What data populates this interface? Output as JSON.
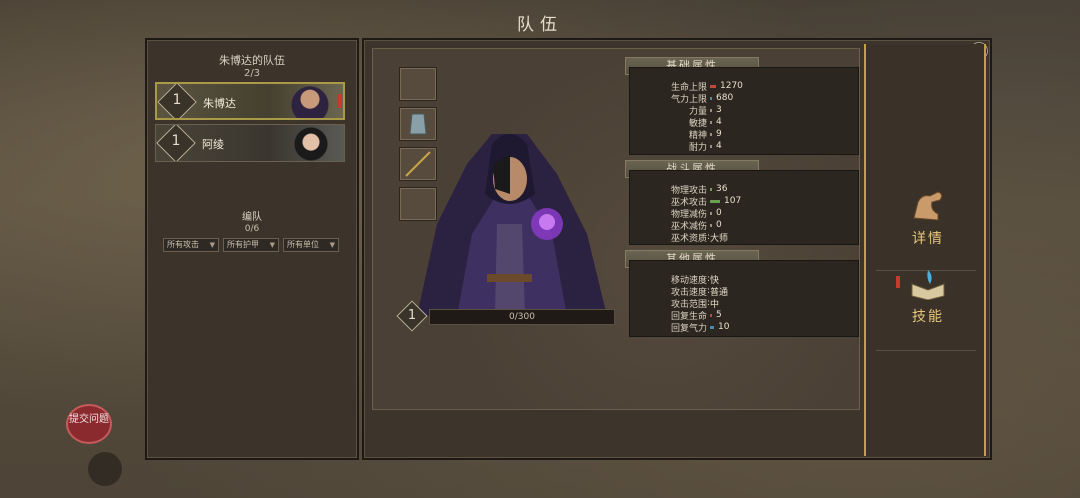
{
  "window_title": "队伍",
  "party": {
    "title": "朱博达的队伍",
    "count": "2/3",
    "members": [
      {
        "level": "1",
        "name": "朱博达",
        "selected": true
      },
      {
        "level": "1",
        "name": "阿绫",
        "selected": false
      }
    ],
    "formation_title": "编队",
    "formation_count": "0/6",
    "filters": [
      "所有攻击",
      "所有护甲",
      "所有单位"
    ]
  },
  "hero": {
    "level": "1",
    "exp": "0/300"
  },
  "sections": [
    {
      "title": "基础属性",
      "rows": [
        {
          "label": "生命上限",
          "sep": "",
          "value": "1270",
          "bar_color": "#c04a3a",
          "fill": 0.05
        },
        {
          "label": "气力上限",
          "sep": "",
          "value": "680",
          "bar_color": "#4a8ab0",
          "fill": 0.02
        },
        {
          "label": "力量",
          "sep": "",
          "value": "3",
          "bar_color": "#9a8f7c",
          "fill": 0.0
        },
        {
          "label": "敏捷",
          "sep": "",
          "value": "4",
          "bar_color": "#9a8f7c",
          "fill": 0.0
        },
        {
          "label": "精神",
          "sep": "",
          "value": "9",
          "bar_color": "#9a8f7c",
          "fill": 0.0
        },
        {
          "label": "耐力",
          "sep": "",
          "value": "4",
          "bar_color": "#9a8f7c",
          "fill": 0.0
        }
      ]
    },
    {
      "title": "战斗属性",
      "rows": [
        {
          "label": "物理攻击",
          "sep": "",
          "value": "36",
          "bar_color": "#6aa050",
          "fill": 0.02
        },
        {
          "label": "巫术攻击",
          "sep": "",
          "value": "107",
          "bar_color": "#6aa050",
          "fill": 0.08
        },
        {
          "label": "物理减伤",
          "sep": "",
          "value": "0",
          "bar_color": "#9a8f7c",
          "fill": 0.0
        },
        {
          "label": "巫术减伤",
          "sep": "",
          "value": "0",
          "bar_color": "#9a8f7c",
          "fill": 0.0
        },
        {
          "label": "巫术资质",
          "sep": ":",
          "value": "大师",
          "bar_color": "",
          "fill": 0.0
        }
      ]
    },
    {
      "title": "其他属性",
      "rows": [
        {
          "label": "移动速度",
          "sep": ":",
          "value": "快",
          "bar_color": "",
          "fill": 0.0
        },
        {
          "label": "攻击速度",
          "sep": ":",
          "value": "普通",
          "bar_color": "",
          "fill": 0.0
        },
        {
          "label": "攻击范围",
          "sep": ":",
          "value": "中",
          "bar_color": "",
          "fill": 0.0
        },
        {
          "label": "回复生命",
          "sep": "",
          "value": "5",
          "bar_color": "#c04a3a",
          "fill": 0.0
        },
        {
          "label": "回复气力",
          "sep": "",
          "value": "10",
          "bar_color": "#4a8ab0",
          "fill": 0.03
        }
      ]
    }
  ],
  "side_tabs": [
    {
      "label": "详情",
      "icon": "flexed-arm-icon"
    },
    {
      "label": "技能",
      "icon": "skill-book-icon"
    }
  ],
  "feedback_label": "提交问题",
  "close_icon": "close-icon"
}
